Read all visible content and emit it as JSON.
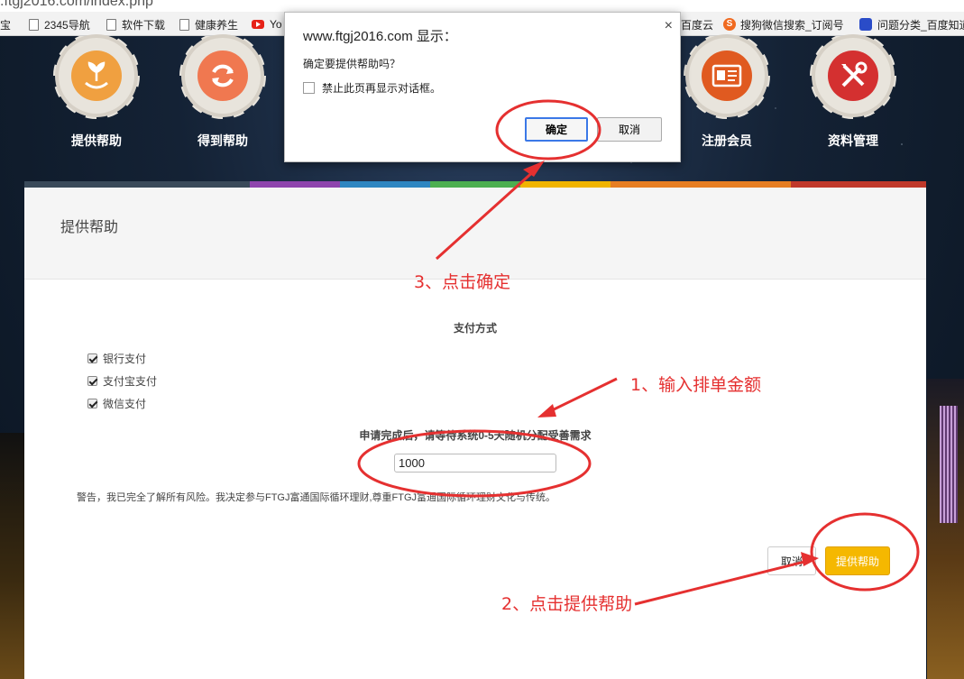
{
  "browser": {
    "url_fragment": ".ftgj2016.com/index.php",
    "bookmarks": [
      {
        "label": "淘宝"
      },
      {
        "label": "2345导航"
      },
      {
        "label": "软件下载"
      },
      {
        "label": "健康养生"
      },
      {
        "label": "Yo"
      },
      {
        "label": "百度云"
      },
      {
        "label": "搜狗微信搜索_订阅号"
      },
      {
        "label": "问题分类_百度知道"
      }
    ]
  },
  "menu": [
    {
      "label": "提供帮助",
      "icon": "give-help-icon",
      "color": "#f0a040"
    },
    {
      "label": "得到帮助",
      "icon": "refresh-icon",
      "color": "#f07850"
    },
    {
      "label": "注册会员",
      "icon": "id-card-icon",
      "color": "#e05a20"
    },
    {
      "label": "资料管理",
      "icon": "tools-icon",
      "color": "#d43030"
    }
  ],
  "stripe_colors": [
    "#3a4a5a",
    "#8e44ad",
    "#2e86c1",
    "#4caf50",
    "#f0b400",
    "#e67e22",
    "#c0392b"
  ],
  "panel": {
    "title": "提供帮助",
    "payment_label": "支付方式",
    "payment_methods": [
      {
        "label": "银行支付",
        "checked": true
      },
      {
        "label": "支付宝支付",
        "checked": true
      },
      {
        "label": "微信支付",
        "checked": true
      }
    ],
    "hint": "申请完成后，请等待系统0-5天随机分配受善需求",
    "amount_value": "1000",
    "warning": "警告，我已完全了解所有风险。我决定参与FTGJ富通国际循环理财,尊重FTGJ富通国际循环理财文化与传统。",
    "cancel_label": "取消",
    "submit_label": "提供帮助"
  },
  "dialog": {
    "title": "www.ftgj2016.com 显示：",
    "message": "确定要提供帮助吗？",
    "checkbox_label": "禁止此页再显示对话框。",
    "ok_label": "确定",
    "cancel_label": "取消",
    "close_glyph": "×"
  },
  "annotations": {
    "step1": "1、输入排单金额",
    "step2": "2、点击提供帮助",
    "step3": "3、点击确定",
    "color": "#e53030"
  }
}
